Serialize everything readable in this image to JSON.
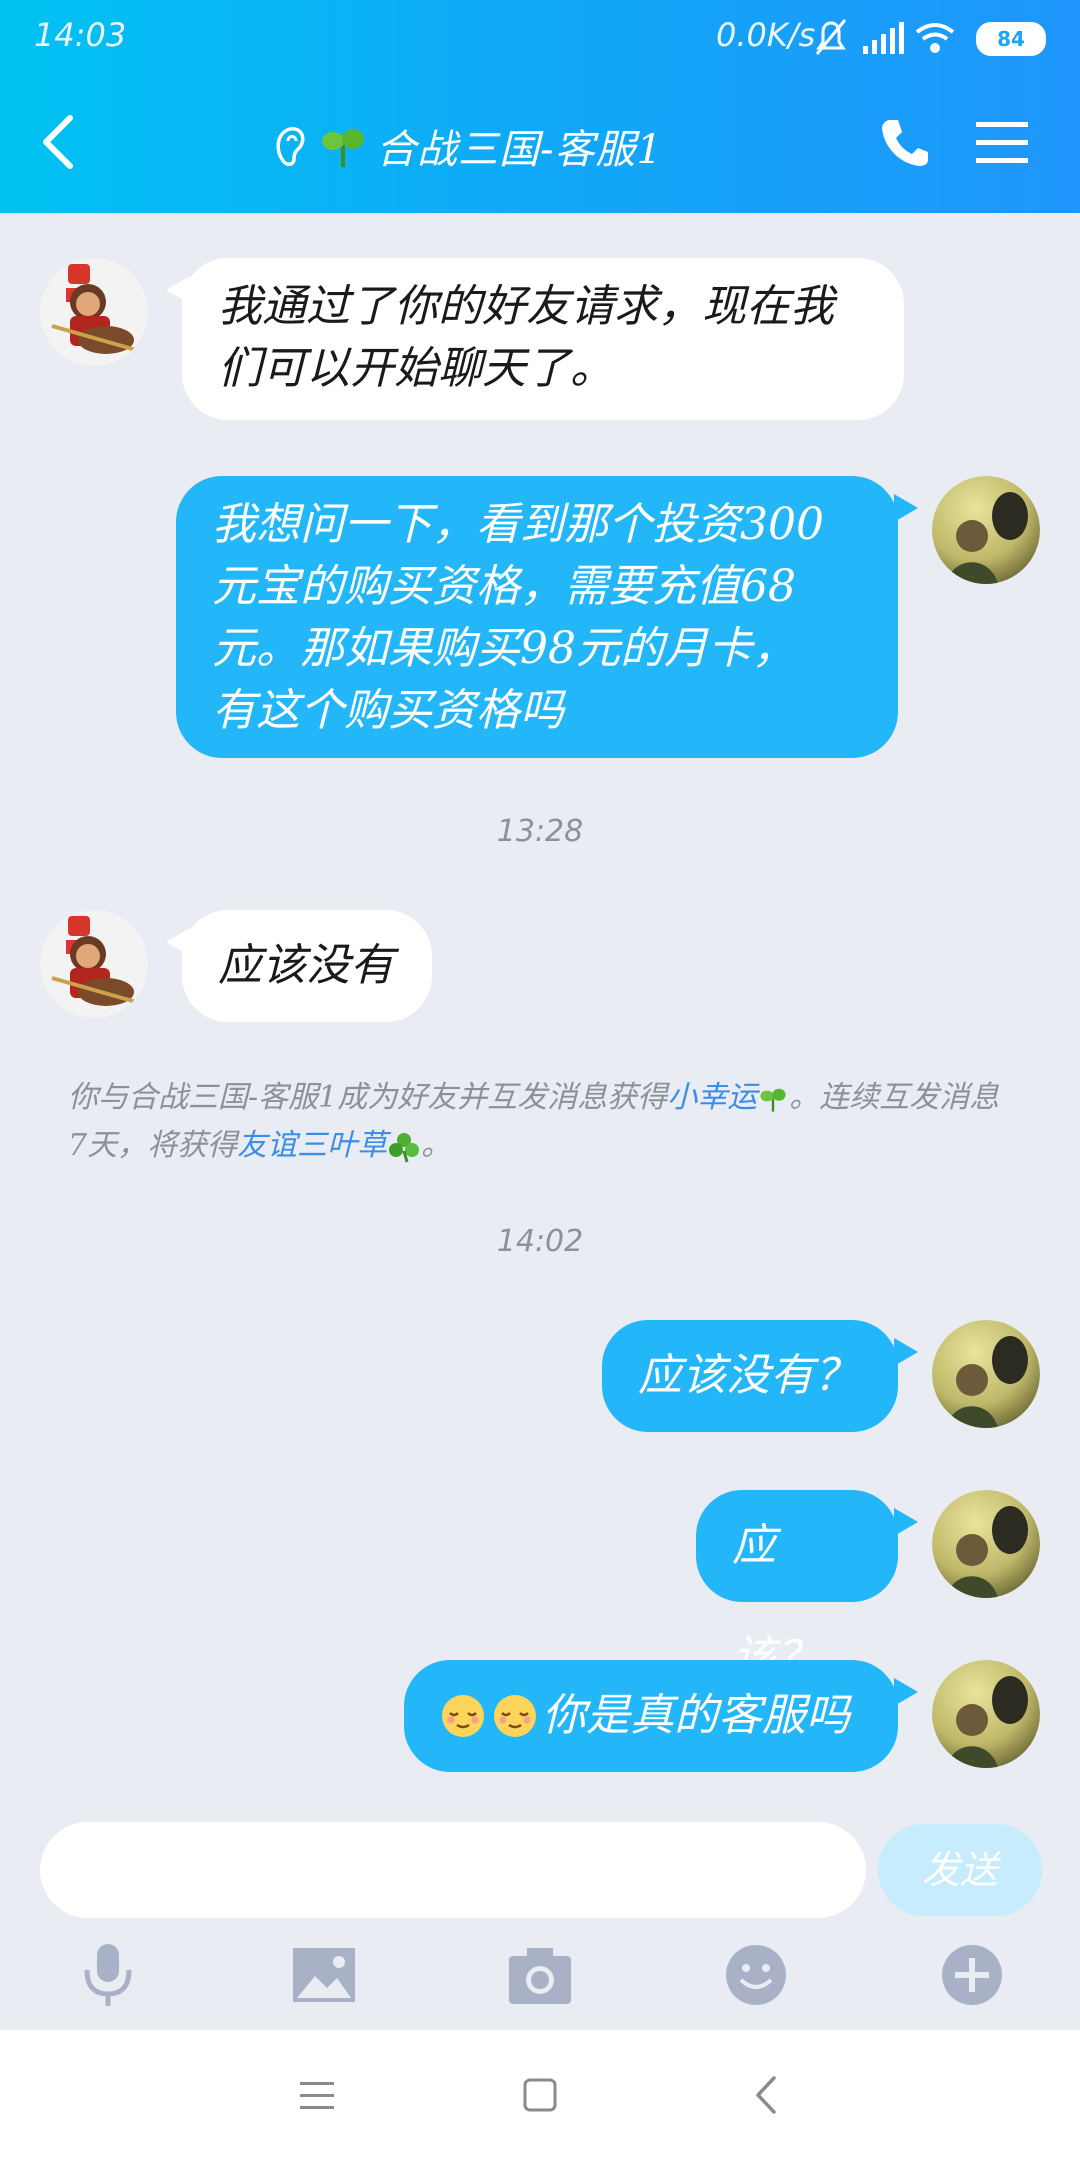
{
  "status_bar": {
    "time": "14:03",
    "network": "0.0K/s",
    "battery": "84"
  },
  "header": {
    "title": "合战三国-客服1"
  },
  "messages": [
    {
      "text_line1": "我通过了你的好友请求，现在我",
      "text_line2": "们可以开始聊天了。"
    },
    {
      "text_line1": "我想问一下，看到那个投资300",
      "text_line2": "元宝的购买资格，需要充值68",
      "text_line3": "元。那如果购买98元的月卡，",
      "text_line4": "有这个购买资格吗"
    },
    {
      "time": "13:28"
    },
    {
      "text": "应该没有"
    },
    {
      "system_part1": "你与合战三国-客服1成为好友并互发消息获得",
      "system_link1": "小幸运",
      "system_part2": "。连续互发消息7天，将获得",
      "system_link2": "友谊三叶草",
      "system_part3": "。"
    },
    {
      "time": "14:02"
    },
    {
      "text": "应该没有？"
    },
    {
      "text": "应该？"
    },
    {
      "text": "你是真的客服吗"
    }
  ],
  "input": {
    "send_label": "发送"
  },
  "colors": {
    "header_start": "#00c2f2",
    "header_end": "#1f96fb",
    "bubble_out": "#23b7fa",
    "bubble_in": "#ffffff",
    "background": "#e9ecf2"
  }
}
